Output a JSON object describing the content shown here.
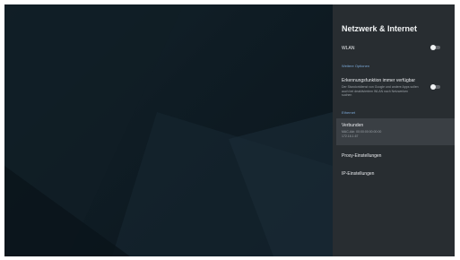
{
  "panel": {
    "title": "Netzwerk & Internet",
    "wlan": {
      "label": "WLAN",
      "enabled": false
    },
    "more_options_header": "Weitere Optionen",
    "scanning": {
      "label": "Erkennungsfunktion immer verfügbar",
      "description": "Der Standortdienst von Google und andere Apps sollen auch bei deaktiviertem WLAN nach Netzwerken suchen",
      "enabled": false
    },
    "ethernet_header": "Ethernet",
    "ethernet": {
      "status": "Verbunden",
      "line1": "MAC-Adr. 00:00:00:00:00:00",
      "line2": "172.16.1.67"
    },
    "proxy_label": "Proxy-Einstellungen",
    "ip_label": "IP-Einstellungen"
  },
  "colors": {
    "panel_background": "#282d31",
    "section_header": "#7aa7d6",
    "backdrop": "#0f1c24"
  }
}
